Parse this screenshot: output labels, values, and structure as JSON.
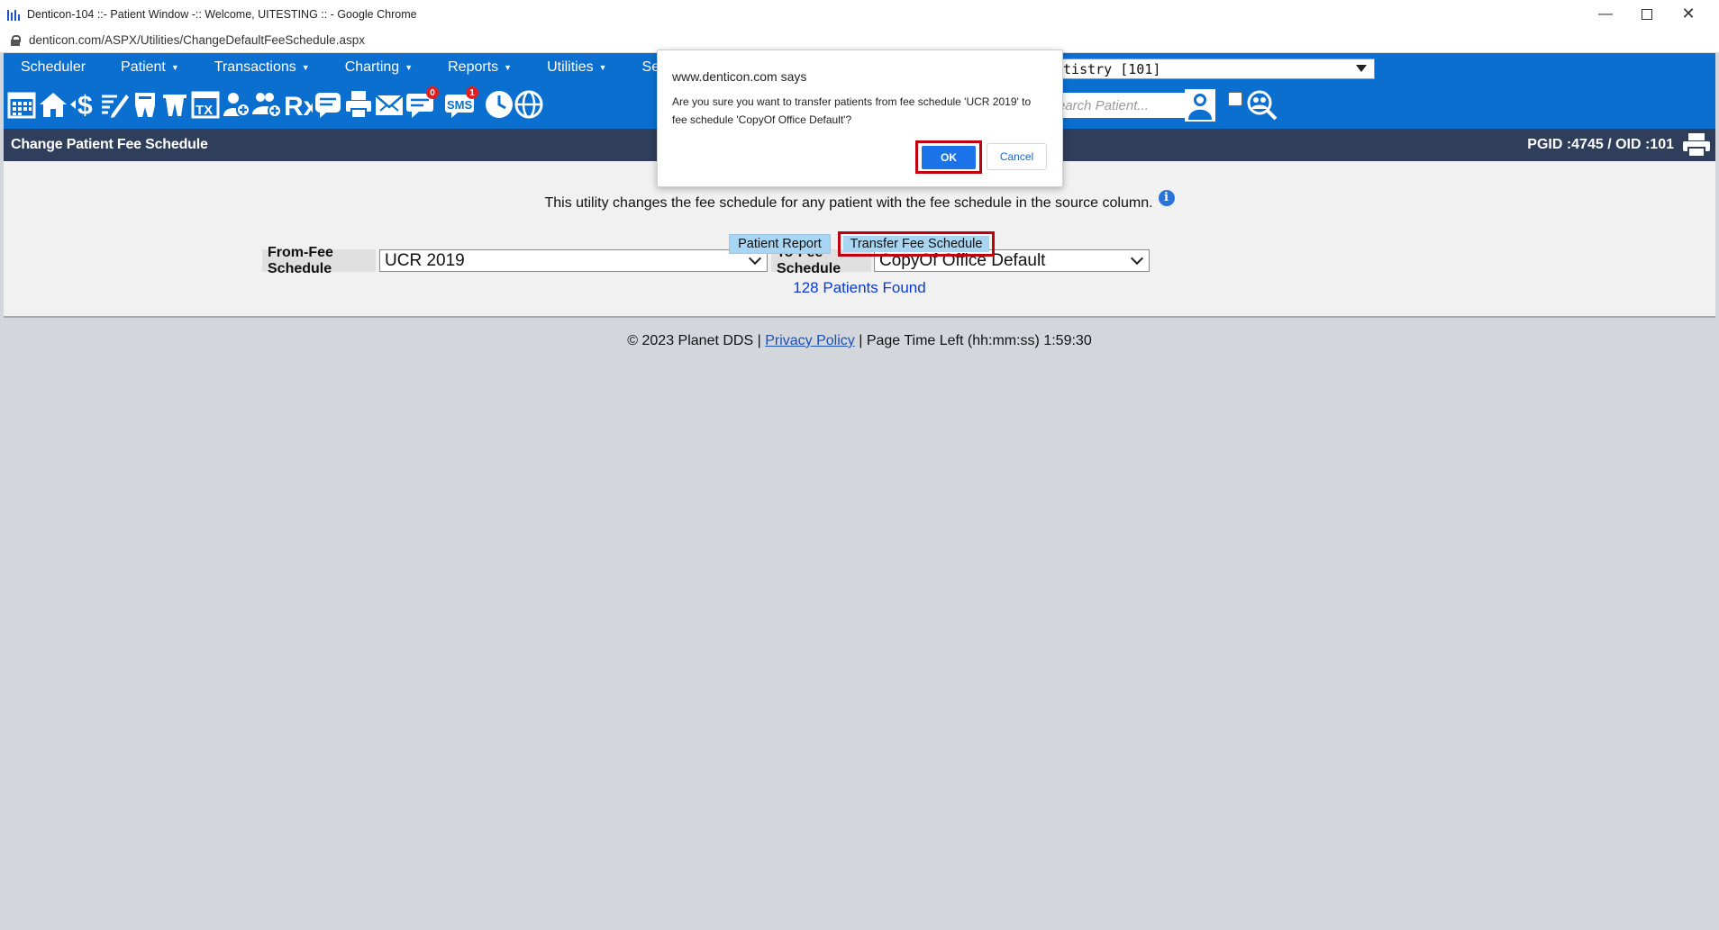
{
  "window": {
    "title": "Denticon-104 ::- Patient Window -:: Welcome, UITESTING :: - Google Chrome",
    "url": "denticon.com/ASPX/Utilities/ChangeDefaultFeeSchedule.aspx"
  },
  "menu": {
    "items": [
      {
        "label": "Scheduler",
        "caret": ""
      },
      {
        "label": "Patient",
        "caret": "▼"
      },
      {
        "label": "Transactions",
        "caret": "▼"
      },
      {
        "label": "Charting",
        "caret": "▼"
      },
      {
        "label": "Reports",
        "caret": "▼"
      },
      {
        "label": "Utilities",
        "caret": "▼"
      },
      {
        "label": "Setup",
        "caret": ""
      }
    ],
    "office_selector_value": "ntistry [101]",
    "search_placeholder": "earch Patient..."
  },
  "toolbar": {
    "badges": {
      "messages": "0",
      "sms": "1"
    },
    "sms_label": "SMS",
    "tx_label": "TX",
    "rx_label": "Rx"
  },
  "page": {
    "title": "Change Patient Fee Schedule",
    "pgid_oid": "PGID :4745  /  OID :101",
    "description": "This utility changes the fee schedule for any patient with the fee schedule in the source column.",
    "info_glyph": "i",
    "from_label": "From-Fee Schedule",
    "from_value": "UCR 2019",
    "to_label": "To-Fee Schedule",
    "to_value": "CopyOf Office Default",
    "patients_found": "128 Patients Found",
    "patient_report_label": "Patient Report",
    "transfer_label": "Transfer Fee Schedule"
  },
  "footer": {
    "copyright": "© 2023 Planet DDS |",
    "privacy": "Privacy Policy",
    "time_left": "|  Page Time Left (hh:mm:ss) 1:59:30"
  },
  "dialog": {
    "origin": "www.denticon.com says",
    "message": "Are you sure you want to transfer patients from fee schedule 'UCR 2019' to fee schedule 'CopyOf Office Default'?",
    "ok_label": "OK",
    "cancel_label": "Cancel"
  },
  "colors": {
    "menu_blue": "#0a6fcf",
    "header_navy": "#2f3e5a",
    "highlight_red": "#c00010",
    "button_blue": "#a8d5f2",
    "ok_blue": "#1a73e8"
  }
}
